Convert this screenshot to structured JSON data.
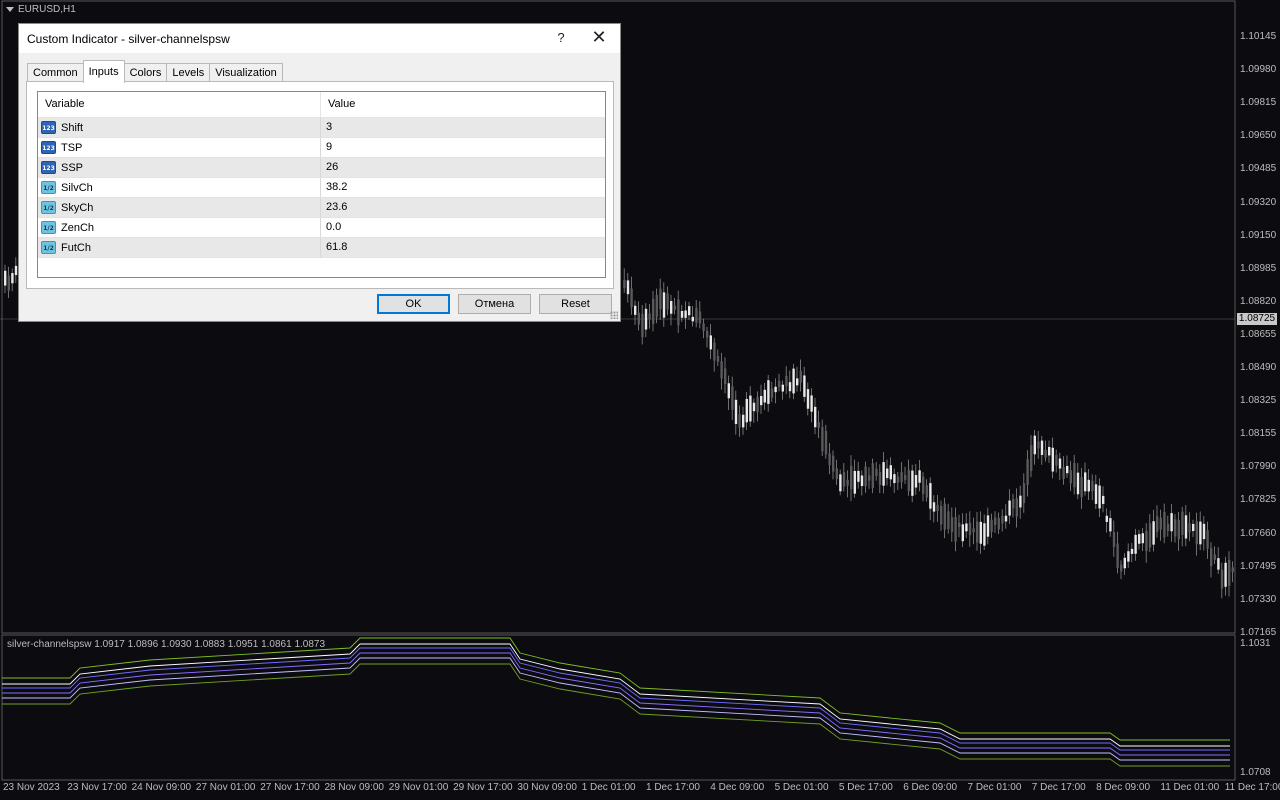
{
  "chart": {
    "symbol": "EURUSD,H1",
    "current_price": "1.08725",
    "price_scale": [
      "1.10145",
      "1.09980",
      "1.09815",
      "1.09650",
      "1.09485",
      "1.09320",
      "1.09150",
      "1.08985",
      "1.08820",
      "1.08655",
      "1.08490",
      "1.08325",
      "1.08155",
      "1.07990",
      "1.07825",
      "1.07660",
      "1.07495",
      "1.07330",
      "1.07165"
    ],
    "time_axis": [
      "23 Nov 2023",
      "23 Nov 17:00",
      "24 Nov 09:00",
      "27 Nov 01:00",
      "27 Nov 17:00",
      "28 Nov 09:00",
      "29 Nov 01:00",
      "29 Nov 17:00",
      "30 Nov 09:00",
      "1 Dec 01:00",
      "1 Dec 17:00",
      "4 Dec 09:00",
      "5 Dec 01:00",
      "5 Dec 17:00",
      "6 Dec 09:00",
      "7 Dec 01:00",
      "7 Dec 17:00",
      "8 Dec 09:00",
      "11 Dec 01:00",
      "11 Dec 17:00"
    ],
    "indicator_label": "silver-channelspsw 1.0917 1.0896 1.0930 1.0883 1.0951 1.0861 1.0873",
    "indicator_scale_top": "1.1031",
    "indicator_scale_bottom": "1.0708"
  },
  "dialog": {
    "title": "Custom Indicator - silver-channelspsw",
    "help": "?",
    "close": "✕",
    "tabs": [
      {
        "label": "Common"
      },
      {
        "label": "Inputs"
      },
      {
        "label": "Colors"
      },
      {
        "label": "Levels"
      },
      {
        "label": "Visualization"
      }
    ],
    "active_tab": "Inputs",
    "columns": {
      "variable": "Variable",
      "value": "Value"
    },
    "rows": [
      {
        "name": "Shift",
        "value": "3",
        "type": "int",
        "icon": "123"
      },
      {
        "name": "TSP",
        "value": "9",
        "type": "int",
        "icon": "123"
      },
      {
        "name": "SSP",
        "value": "26",
        "type": "int",
        "icon": "123"
      },
      {
        "name": "SilvCh",
        "value": "38.2",
        "type": "double",
        "icon": "1/2"
      },
      {
        "name": "SkyCh",
        "value": "23.6",
        "type": "double",
        "icon": "1/2"
      },
      {
        "name": "ZenCh",
        "value": "0.0",
        "type": "double",
        "icon": "1/2"
      },
      {
        "name": "FutCh",
        "value": "61.8",
        "type": "double",
        "icon": "1/2"
      }
    ],
    "buttons": {
      "ok": "OK",
      "cancel": "Отмена",
      "reset": "Reset"
    }
  }
}
